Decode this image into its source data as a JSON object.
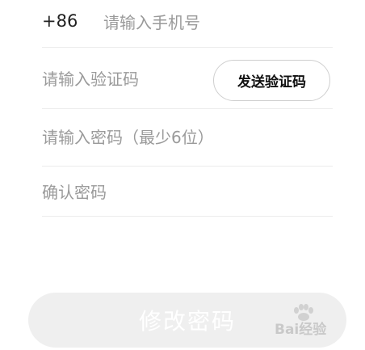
{
  "form": {
    "phone": {
      "prefix": "+86",
      "placeholder": "请输入手机号",
      "value": ""
    },
    "code": {
      "placeholder": "请输入验证码",
      "value": "",
      "send_label": "发送验证码"
    },
    "password": {
      "placeholder": "请输入密码（最少6位）",
      "value": ""
    },
    "confirm": {
      "placeholder": "确认密码",
      "value": ""
    },
    "submit_label": "修改密码"
  },
  "watermark": {
    "text": "Bai经验"
  },
  "colors": {
    "placeholder": "#9a9a9a",
    "divider": "#ebebeb",
    "submit_disabled_bg": "#efefef",
    "send_border": "#cfcfcf"
  }
}
